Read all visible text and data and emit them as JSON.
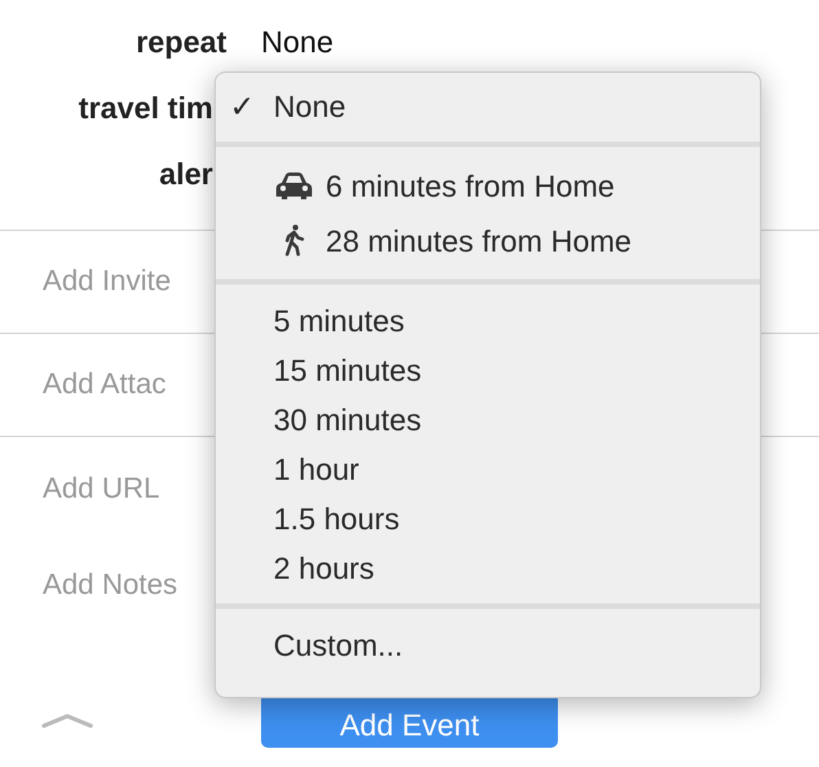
{
  "form": {
    "rows": [
      {
        "label": "repeat",
        "value": "None"
      },
      {
        "label": "travel tim"
      },
      {
        "label": "aler"
      }
    ]
  },
  "fields": [
    {
      "placeholder": "Add Invite",
      "divider_below": true
    },
    {
      "placeholder": "Add Attac",
      "divider_below": true
    },
    {
      "placeholder": "Add URL",
      "divider_below": false
    },
    {
      "placeholder": "Add Notes",
      "divider_below": false
    }
  ],
  "add_event_button": {
    "label": "Add Event"
  },
  "menu": {
    "check_mark": "✓",
    "sections": [
      [
        {
          "label": "None",
          "selected": true
        }
      ],
      [
        {
          "label": "6 minutes from Home",
          "kind": "car",
          "selected": false
        },
        {
          "label": "28 minutes from Home",
          "kind": "walk",
          "selected": false
        }
      ],
      [
        {
          "label": "5 minutes",
          "selected": false
        },
        {
          "label": "15 minutes",
          "selected": false
        },
        {
          "label": "30 minutes",
          "selected": false
        },
        {
          "label": "1 hour",
          "selected": false
        },
        {
          "label": "1.5 hours",
          "selected": false
        },
        {
          "label": "2 hours",
          "selected": false
        }
      ],
      [
        {
          "label": "Custom...",
          "selected": false
        }
      ]
    ]
  }
}
